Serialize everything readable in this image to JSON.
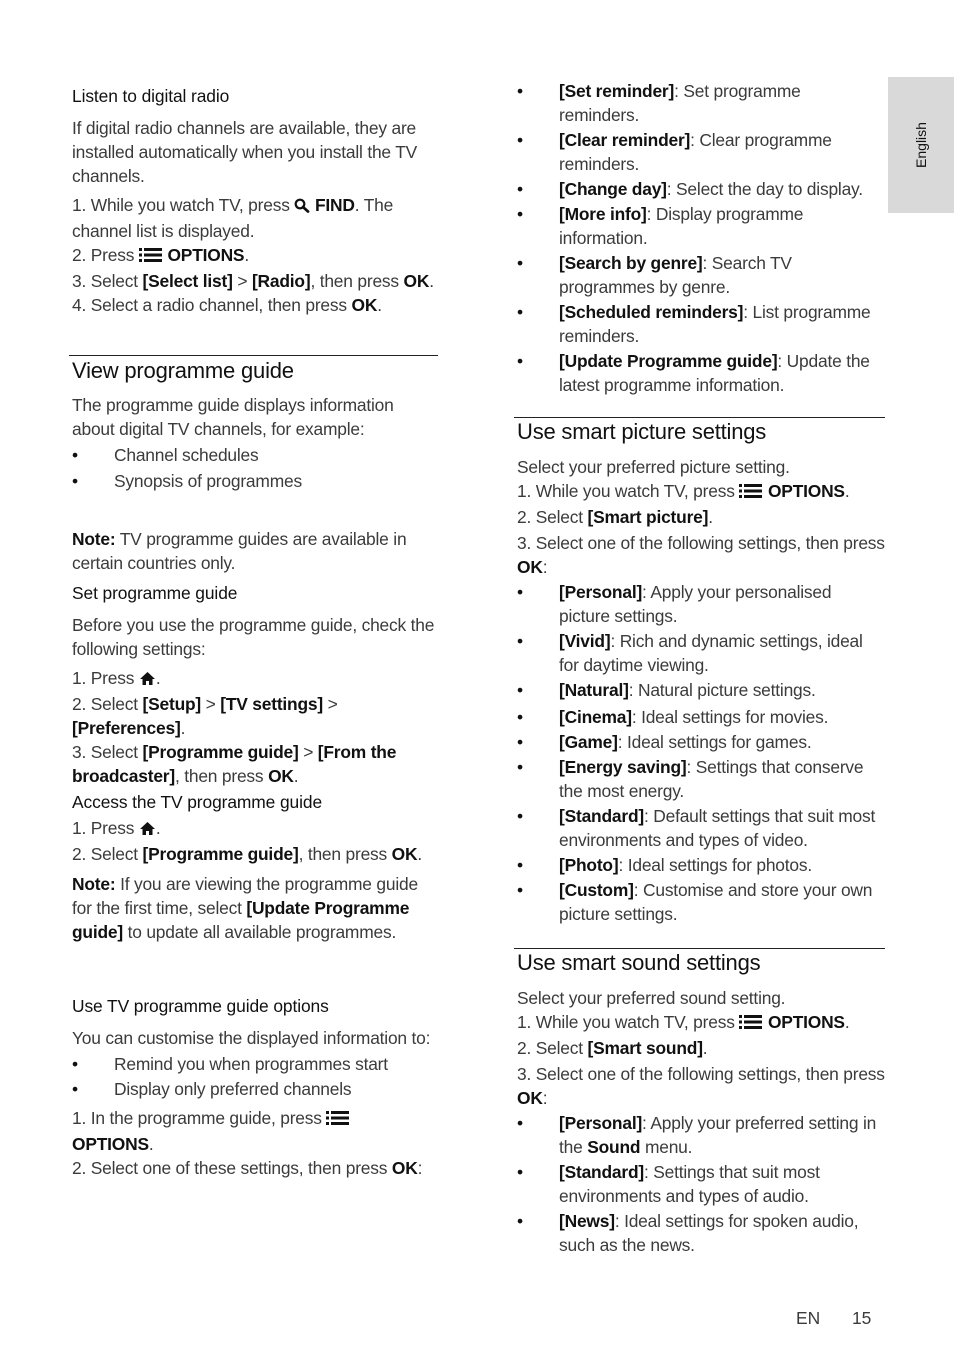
{
  "side_tab": {
    "label": "English"
  },
  "footer": {
    "lang": "EN",
    "page": "15"
  },
  "left": {
    "radio": {
      "title": "Listen to digital radio",
      "intro": "If digital radio channels are available, they are installed automatically when you install the TV channels.",
      "step1_a": "1. While you watch TV, press ",
      "step1_b": "FIND",
      "step1_c": ". The channel list is displayed.",
      "step2_a": "2. Press ",
      "step2_b": "OPTIONS",
      "step2_c": ".",
      "step3_a": "3. Select ",
      "step3_b": "[Select list]",
      "step3_c": " > ",
      "step3_d": "[Radio]",
      "step3_e": ", then press ",
      "step3_f": "OK",
      "step3_g": ".",
      "step4_a": "4. Select a radio channel, then press ",
      "step4_b": "OK",
      "step4_c": "."
    },
    "guide": {
      "heading": "View programme guide",
      "intro": "The programme guide displays information about digital TV channels, for example:",
      "bullets": [
        "Channel schedules",
        "Synopsis of programmes"
      ],
      "note_label": "Note:",
      "note_text": " TV programme guides are available in certain countries only."
    },
    "set_guide": {
      "title": "Set programme guide",
      "intro": "Before you use the programme guide, check the following settings:",
      "step1_a": "1. Press ",
      "step1_c": ".",
      "step2_a": "2. Select ",
      "step2_b": "[Setup]",
      "step2_c": " > ",
      "step2_d": "[TV settings]",
      "step2_e": " > ",
      "step2_f": "[Preferences]",
      "step2_g": ".",
      "step3_a": "3. Select ",
      "step3_b": "[Programme guide]",
      "step3_c": " > ",
      "step3_d": "[From the broadcaster]",
      "step3_e": ", then press ",
      "step3_f": "OK",
      "step3_g": "."
    },
    "access_guide": {
      "title": "Access the TV programme guide",
      "step1_a": "1. Press ",
      "step1_c": ".",
      "step2_a": "2. Select ",
      "step2_b": "[Programme guide]",
      "step2_c": ", then press ",
      "step2_d": "OK",
      "step2_e": ".",
      "note_label": "Note:",
      "note_a": " If you are viewing the programme guide for the first time, select ",
      "note_b": "[Update Programme guide]",
      "note_c": " to update all available programmes."
    },
    "guide_options": {
      "title": "Use TV programme guide options",
      "intro": "You can customise the displayed information to:",
      "bullets": [
        "Remind you when programmes start",
        "Display only preferred channels"
      ],
      "step1_a": "1. In the programme guide, press ",
      "step1_b": "OPTIONS",
      "step1_c": ".",
      "step2_a": "2. Select one of these settings, then press ",
      "step2_b": "OK",
      "step2_c": ":"
    }
  },
  "right": {
    "guide_option_items": [
      {
        "label": "[Set reminder]",
        "desc": ": Set programme reminders."
      },
      {
        "label": "[Clear reminder]",
        "desc": ": Clear programme reminders."
      },
      {
        "label": "[Change day]",
        "desc": ": Select the day to display."
      },
      {
        "label": "[More info]",
        "desc": ": Display programme information."
      },
      {
        "label": "[Search by genre]",
        "desc": ": Search TV programmes by genre."
      },
      {
        "label": "[Scheduled reminders]",
        "desc": ": List programme reminders."
      },
      {
        "label": "[Update Programme guide]",
        "desc": ": Update the latest programme information."
      }
    ],
    "picture": {
      "heading": "Use smart picture settings",
      "intro": "Select your preferred picture setting.",
      "step1_a": "1. While you watch TV, press ",
      "step1_b": "OPTIONS",
      "step1_c": ".",
      "step2_a": "2. Select ",
      "step2_b": "[Smart picture]",
      "step2_c": ".",
      "step3_a": "3. Select one of the following settings, then press ",
      "step3_b": "OK",
      "step3_c": ":",
      "items_a": [
        {
          "label": "[Personal]",
          "desc": ": Apply your personalised picture settings."
        },
        {
          "label": "[Vivid]",
          "desc": ": Rich and dynamic settings, ideal for daytime viewing."
        },
        {
          "label": "[Natural]",
          "desc": ": Natural picture settings."
        }
      ],
      "items_b": [
        {
          "label": "[Cinema]",
          "desc": ": Ideal settings for movies."
        },
        {
          "label": "[Game]",
          "desc": ": Ideal settings for games."
        },
        {
          "label": "[Energy saving]",
          "desc": ": Settings that conserve the most energy."
        },
        {
          "label": "[Standard]",
          "desc": ": Default settings that suit most environments and types of video."
        },
        {
          "label": "[Photo]",
          "desc": ": Ideal settings for photos."
        },
        {
          "label": "[Custom]",
          "desc": ": Customise and store your own picture settings."
        }
      ]
    },
    "sound": {
      "heading": "Use smart sound settings",
      "intro": "Select your preferred sound setting.",
      "step1_a": "1. While you watch TV, press ",
      "step1_b": "OPTIONS",
      "step1_c": ".",
      "step2_a": "2. Select ",
      "step2_b": "[Smart sound]",
      "step2_c": ".",
      "step3_a": "3. Select one of the following settings, then press ",
      "step3_b": "OK",
      "step3_c": ":",
      "personal_label": "[Personal]",
      "personal_a": ": Apply your preferred setting in the ",
      "personal_b": "Sound",
      "personal_c": " menu.",
      "items": [
        {
          "label": "[Standard]",
          "desc": ": Settings that suit most environments and types of audio."
        },
        {
          "label": "[News]",
          "desc": ": Ideal settings for spoken audio, such as the news."
        }
      ]
    }
  }
}
